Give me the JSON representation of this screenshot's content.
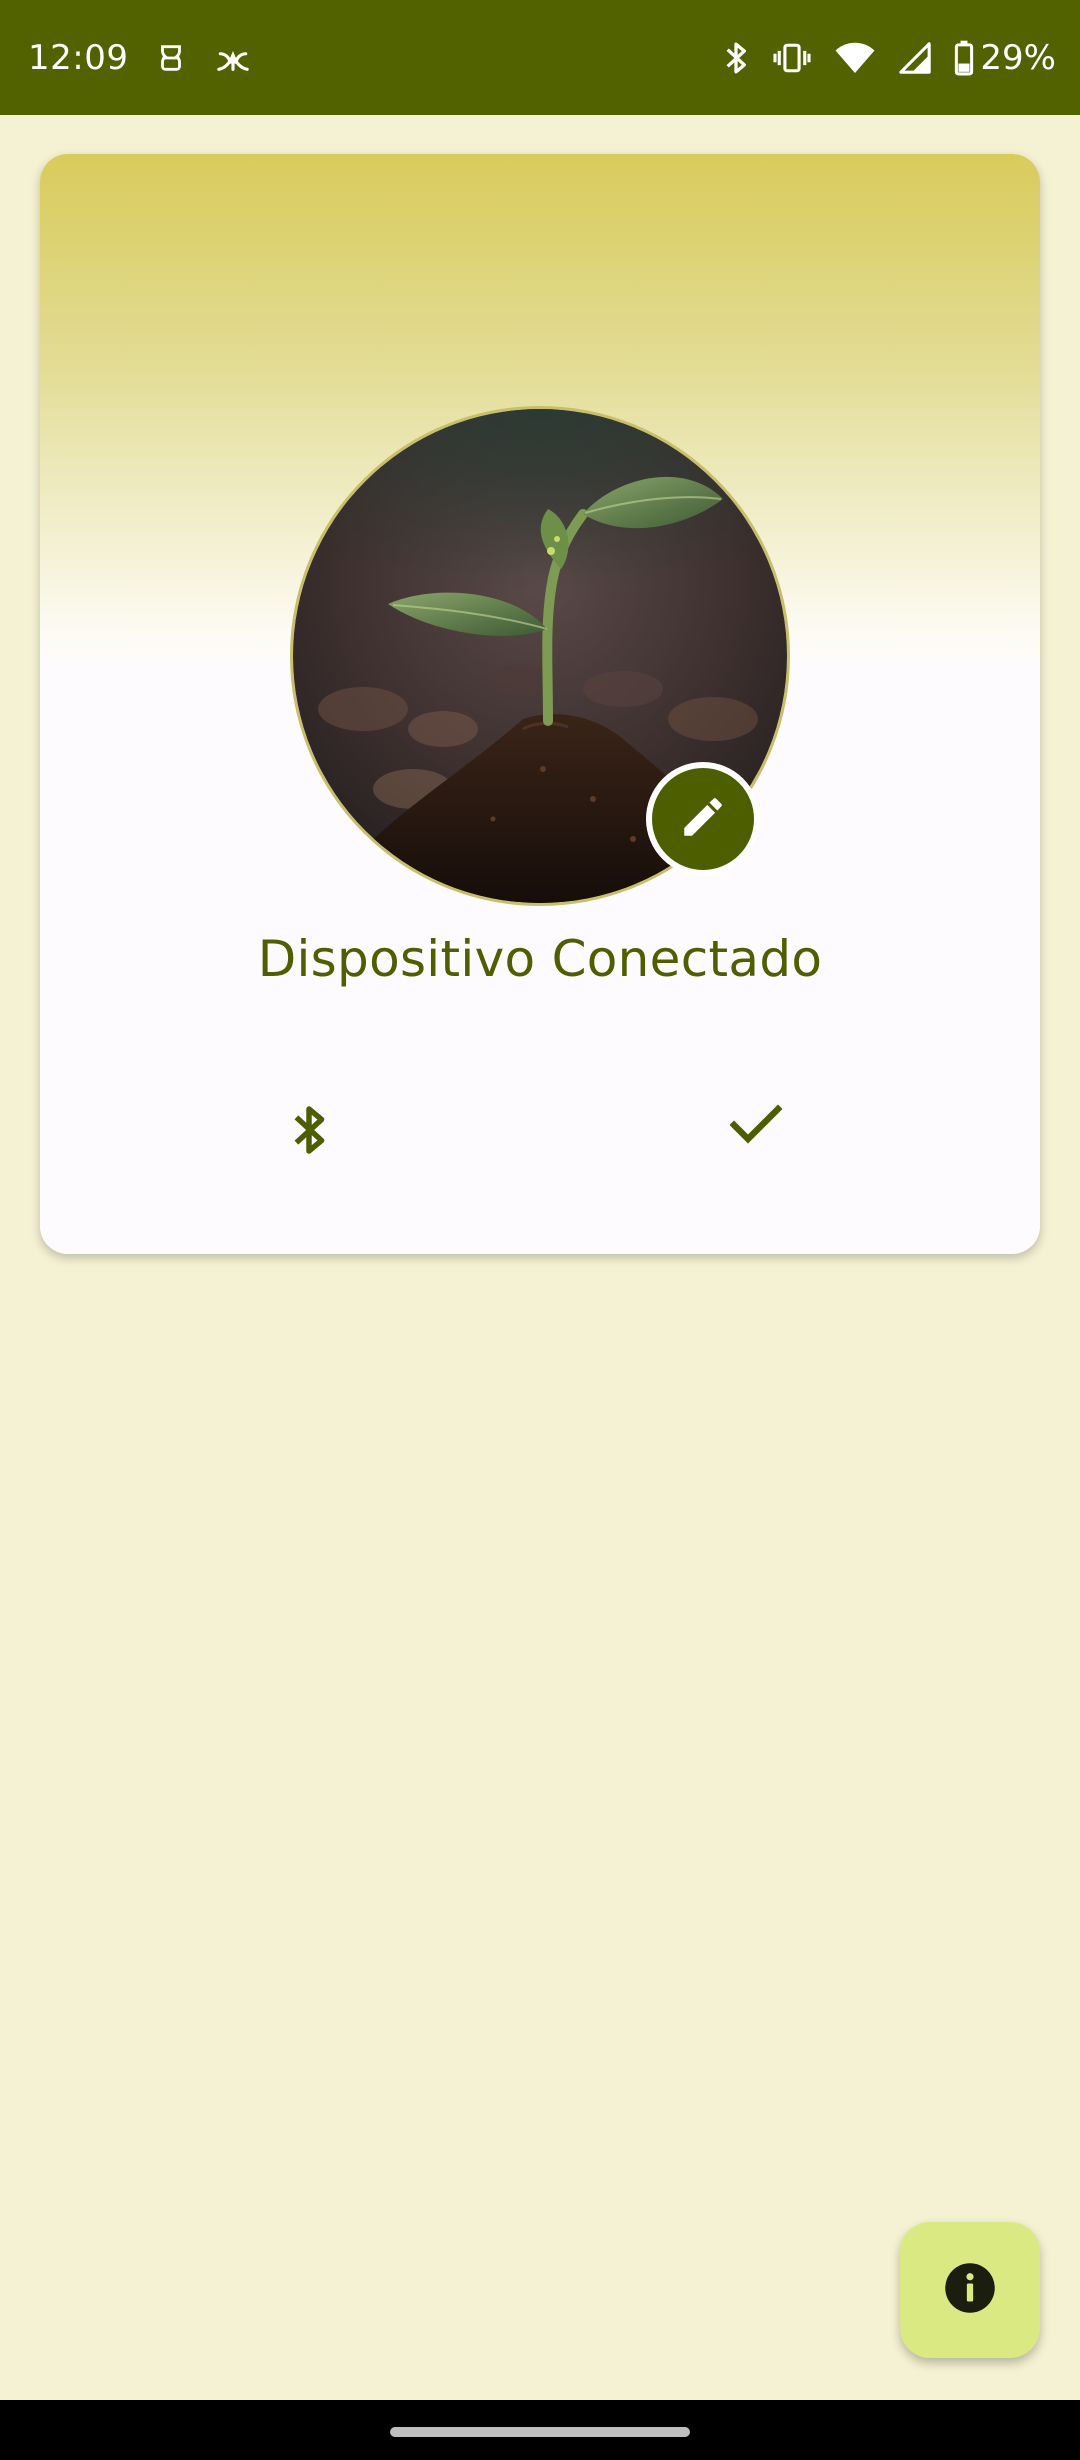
{
  "status_bar": {
    "time": "12:09",
    "battery": "29%",
    "icons": [
      "glasses-notification-icon",
      "plant-notification-icon",
      "bluetooth-icon",
      "vibrate-icon",
      "wifi-icon",
      "signal-icon",
      "battery-icon"
    ],
    "background": "#536200"
  },
  "device_card": {
    "title": "Dispositivo Conectado",
    "image": "plant-seedling-photo",
    "edit_icon": "pencil-icon",
    "bluetooth_icon": "bluetooth-icon",
    "status_icon": "check-icon"
  },
  "fab": {
    "icon": "info-icon"
  },
  "colors": {
    "primary": "#4d5e00",
    "background": "#f5f1d3",
    "fab": "#dbe983",
    "gradient_top": "#d9cb5b"
  }
}
